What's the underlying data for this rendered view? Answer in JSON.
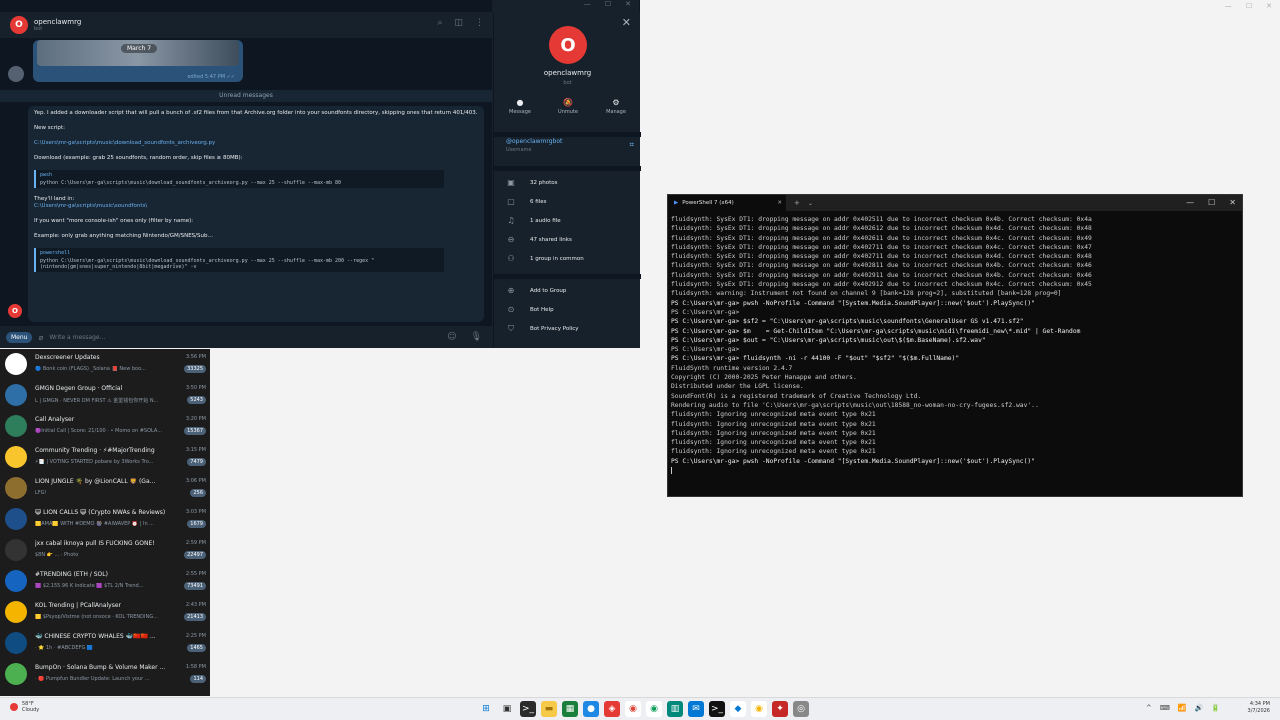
{
  "desktop": {
    "controls": [
      "—",
      "☐",
      "✕"
    ]
  },
  "telegram": {
    "window_controls": [
      "—",
      "☐",
      "✕"
    ],
    "header": {
      "avatar_letter": "O",
      "name": "openclawmrg",
      "status": "bot"
    },
    "image_msg": {
      "date": "March 7",
      "time": "edited 5:47 PM ✓✓"
    },
    "unread_label": "Unread messages",
    "message": {
      "p1": "Yep. I added a downloader script that will pull a bunch of .sf2 files from that Archive.org folder into your soundfonts directory, skipping ones that return 401/403.",
      "p2_label": "New script:",
      "p2_path": "C:\\Users\\mr-ga\\scripts\\music\\download_soundfonts_archiveorg.py",
      "p3": "Download (example: grab 25 soundfonts, random order, skip files ≥ 80MB):",
      "code1_lang": "pwsh",
      "code1": "python C:\\Users\\mr-ga\\scripts\\music\\download_soundfonts_archiveorg.py --max 25 --shuffle --max-mb 80",
      "p4_label": "They'll land in:",
      "p4_path": "C:\\Users\\mr-ga\\scripts\\music\\soundfonts\\",
      "p5": "If you want \"more console-ish\" ones only (filter by name):",
      "p6": "Example: only grab anything matching Nintendo/GM/SNES/Sub…",
      "code2_lang": "powershell",
      "code2": "python C:\\Users\\mr-ga\\scripts\\music\\download_soundfonts_archiveorg.py --max 25 --shuffle --max-mb 200 --regex \"(nintendo|gm|snes|super_nintendo|8bit|megadrive)\" -v"
    },
    "composer": {
      "menu": "Menu",
      "placeholder": "Write a message..."
    }
  },
  "profile": {
    "avatar_letter": "O",
    "name": "openclawmrg",
    "sub": "bot",
    "actions": [
      {
        "icon": "●",
        "label": "Message"
      },
      {
        "icon": "🔕",
        "label": "Unmute"
      },
      {
        "icon": "⚙",
        "label": "Manage"
      }
    ],
    "username": "@openclawmrgbot",
    "username_label": "Username",
    "media": [
      {
        "icon": "▣",
        "label": "32 photos"
      },
      {
        "icon": "▢",
        "label": "6 files"
      },
      {
        "icon": "♫",
        "label": "1 audio file"
      },
      {
        "icon": "⊖",
        "label": "47 shared links"
      },
      {
        "icon": "⚇",
        "label": "1 group in common"
      }
    ],
    "bot_actions": [
      {
        "icon": "⊕",
        "label": "Add to Group"
      },
      {
        "icon": "⊙",
        "label": "Bot Help"
      },
      {
        "icon": "⛉",
        "label": "Bot Privacy Policy"
      }
    ]
  },
  "chats": [
    {
      "title": "Dexscreener Updates",
      "preview": "🔵 Bonk coin (FLAGS) _Solana 📕 New boo...",
      "time": "3:56 PM",
      "badge": "33325",
      "color": "#ffffff"
    },
    {
      "title": "GMGN Degen Group · Official",
      "preview": "L | GMGN · NEVER DM FIRST ⚠ 金鉴钱包你开始 N...",
      "time": "3:50 PM",
      "badge": "5243",
      "color": "#2f6fa8"
    },
    {
      "title": "Call Analyser",
      "preview": "🟣Initial Call | Score: 21/100 · • Momo on #SOLA...",
      "time": "3:20 PM",
      "badge": "15367",
      "color": "#2e7d5b"
    },
    {
      "title": "Community Trending · ⚡#MajorTrending",
      "preview": "⚡📑 | VOTING STARTED pobare by 3Works Tro...",
      "time": "3:15 PM",
      "badge": "7479",
      "color": "#f9c52c"
    },
    {
      "title": "LION JUNGLE 🌴 by @LionCALL 🦁 (Ga...",
      "preview": "LFG!",
      "time": "3:06 PM",
      "badge": "256",
      "color": "#8d6e2f"
    },
    {
      "title": "😺 LION CALLS 😺 (Crypto NWAs & Reviews)",
      "preview": "🟨AMA🟨 WITH #DEMO 🎡 #AIWAVEP ⏰ | In ...",
      "time": "3:03 PM",
      "badge": "1679",
      "color": "#1e4f8a"
    },
    {
      "title": "jxx cabal iknoya pull IS FUCKING GONE!",
      "preview": "$8N 👉 ... · Photo",
      "time": "2:59 PM",
      "badge": "22497",
      "color": "#333333"
    },
    {
      "title": "#TRENDING (ETH / SOL)",
      "preview": "🟪 $2,155.96 K Indicate 🟪 $TL 2/N Trend...",
      "time": "2:55 PM",
      "badge": "73491",
      "color": "#1565c0"
    },
    {
      "title": "KOL Trending | PCallAnalyser",
      "preview": "🟨 $Psyop/Vistme (not onsoce · KOL TRENDING...",
      "time": "2:43 PM",
      "badge": "21413",
      "color": "#f5b400"
    },
    {
      "title": "🐳 CHINESE CRYPTO WHALES 🐳🇨🇳🇨🇳 ...",
      "preview": "· ⭐ 1h · #ABCDEFG 🟦",
      "time": "2:25 PM",
      "badge": "1465",
      "color": "#0f4c81"
    },
    {
      "title": "BumpOn · Solana Bump & Volume Maker ...",
      "preview": "· 🔴 Pumpfun Bundler Update: Launch your ...",
      "time": "1:58 PM",
      "badge": "114",
      "color": "#4caf50"
    }
  ],
  "powershell": {
    "tab_title": "PowerShell 7 (x64)",
    "lines": [
      {
        "t": "fluidsynth: SysEx DT1: dropping message on addr 0x402511 due to incorrect checksum 0x4b. Correct checksum: 0x4a",
        "c": ""
      },
      {
        "t": "fluidsynth: SysEx DT1: dropping message on addr 0x402612 due to incorrect checksum 0x4d. Correct checksum: 0x48",
        "c": ""
      },
      {
        "t": "fluidsynth: SysEx DT1: dropping message on addr 0x402611 due to incorrect checksum 0x4c. Correct checksum: 0x49",
        "c": ""
      },
      {
        "t": "fluidsynth: SysEx DT1: dropping message on addr 0x402711 due to incorrect checksum 0x4c. Correct checksum: 0x47",
        "c": ""
      },
      {
        "t": "fluidsynth: SysEx DT1: dropping message on addr 0x402711 due to incorrect checksum 0x4d. Correct checksum: 0x48",
        "c": ""
      },
      {
        "t": "fluidsynth: SysEx DT1: dropping message on addr 0x402811 due to incorrect checksum 0x4b. Correct checksum: 0x46",
        "c": ""
      },
      {
        "t": "fluidsynth: SysEx DT1: dropping message on addr 0x402911 due to incorrect checksum 0x4b. Correct checksum: 0x46",
        "c": ""
      },
      {
        "t": "fluidsynth: SysEx DT1: dropping message on addr 0x402912 due to incorrect checksum 0x4c. Correct checksum: 0x45",
        "c": ""
      },
      {
        "t": "fluidsynth: warning: Instrument not found on channel 9 [bank=128 prog=2], substituted [bank=128 prog=0]",
        "c": ""
      },
      {
        "t": "PS C:\\Users\\mr-ga> pwsh -NoProfile -Command \"[System.Media.SoundPlayer]::new('$out').PlaySync()\"",
        "c": "cmd"
      },
      {
        "t": "PS C:\\Users\\mr-ga>",
        "c": ""
      },
      {
        "t": "PS C:\\Users\\mr-ga> $sf2 = \"C:\\Users\\mr-ga\\scripts\\music\\soundfonts\\GeneralUser GS v1.471.sf2\"",
        "c": "cmd"
      },
      {
        "t": "PS C:\\Users\\mr-ga> $m    = Get-ChildItem \"C:\\Users\\mr-ga\\scripts\\music\\midi\\freemidi_new\\*.mid\" | Get-Random",
        "c": "cmd"
      },
      {
        "t": "PS C:\\Users\\mr-ga> $out = \"C:\\Users\\mr-ga\\scripts\\music\\out\\$($m.BaseName).sf2.wav\"",
        "c": "cmd"
      },
      {
        "t": "PS C:\\Users\\mr-ga>",
        "c": ""
      },
      {
        "t": "PS C:\\Users\\mr-ga> fluidsynth -ni -r 44100 -F \"$out\" \"$sf2\" \"$($m.FullName)\"",
        "c": "cmd"
      },
      {
        "t": "FluidSynth runtime version 2.4.7",
        "c": ""
      },
      {
        "t": "Copyright (C) 2000-2025 Peter Hanappe and others.",
        "c": ""
      },
      {
        "t": "Distributed under the LGPL license.",
        "c": ""
      },
      {
        "t": "SoundFont(R) is a registered trademark of Creative Technology Ltd.",
        "c": ""
      },
      {
        "t": "",
        "c": ""
      },
      {
        "t": "Rendering audio to file 'C:\\Users\\mr-ga\\scripts\\music\\out\\18588_no-woman-no-cry-fugees.sf2.wav'..",
        "c": ""
      },
      {
        "t": "fluidsynth: Ignoring unrecognized meta event type 0x21",
        "c": ""
      },
      {
        "t": "fluidsynth: Ignoring unrecognized meta event type 0x21",
        "c": ""
      },
      {
        "t": "fluidsynth: Ignoring unrecognized meta event type 0x21",
        "c": ""
      },
      {
        "t": "fluidsynth: Ignoring unrecognized meta event type 0x21",
        "c": ""
      },
      {
        "t": "fluidsynth: Ignoring unrecognized meta event type 0x21",
        "c": ""
      },
      {
        "t": "PS C:\\Users\\mr-ga> pwsh -NoProfile -Command \"[System.Media.SoundPlayer]::new('$out').PlaySync()\"",
        "c": "cmd"
      }
    ]
  },
  "taskbar": {
    "weather_temp": "58°F",
    "weather_desc": "Cloudy",
    "time": "4:34 PM",
    "date": "3/7/2026",
    "tray": [
      "^",
      "⌨",
      "📶",
      "🔊",
      "🔋"
    ],
    "icons": [
      {
        "name": "start",
        "glyph": "⊞",
        "bg": "transparent",
        "fg": "#0078d4"
      },
      {
        "name": "taskview",
        "glyph": "▣",
        "bg": "transparent",
        "fg": "#333"
      },
      {
        "name": "terminal",
        "glyph": ">_",
        "bg": "#2b2b2b",
        "fg": "#fff"
      },
      {
        "name": "explorer",
        "glyph": "▬",
        "bg": "#f7c948",
        "fg": "#a0720a"
      },
      {
        "name": "store",
        "glyph": "▦",
        "bg": "#1a7f3c",
        "fg": "#fff"
      },
      {
        "name": "app1",
        "glyph": "●",
        "bg": "#1e88e5",
        "fg": "#fff"
      },
      {
        "name": "app2",
        "glyph": "◈",
        "bg": "#e53935",
        "fg": "#fff"
      },
      {
        "name": "chrome1",
        "glyph": "◉",
        "bg": "#fff",
        "fg": "#db4437"
      },
      {
        "name": "chrome2",
        "glyph": "◉",
        "bg": "#fff",
        "fg": "#0f9d58"
      },
      {
        "name": "app3",
        "glyph": "▥",
        "bg": "#00897b",
        "fg": "#fff"
      },
      {
        "name": "app4",
        "glyph": "✉",
        "bg": "#0078d4",
        "fg": "#fff"
      },
      {
        "name": "app5",
        "glyph": ">_",
        "bg": "#111",
        "fg": "#fff"
      },
      {
        "name": "app6",
        "glyph": "◆",
        "bg": "#fff",
        "fg": "#0078d4"
      },
      {
        "name": "chrome3",
        "glyph": "◉",
        "bg": "#fff",
        "fg": "#f4b400"
      },
      {
        "name": "app7",
        "glyph": "✦",
        "bg": "#c62828",
        "fg": "#fff"
      },
      {
        "name": "app8",
        "glyph": "◎",
        "bg": "#888",
        "fg": "#fff"
      }
    ]
  }
}
